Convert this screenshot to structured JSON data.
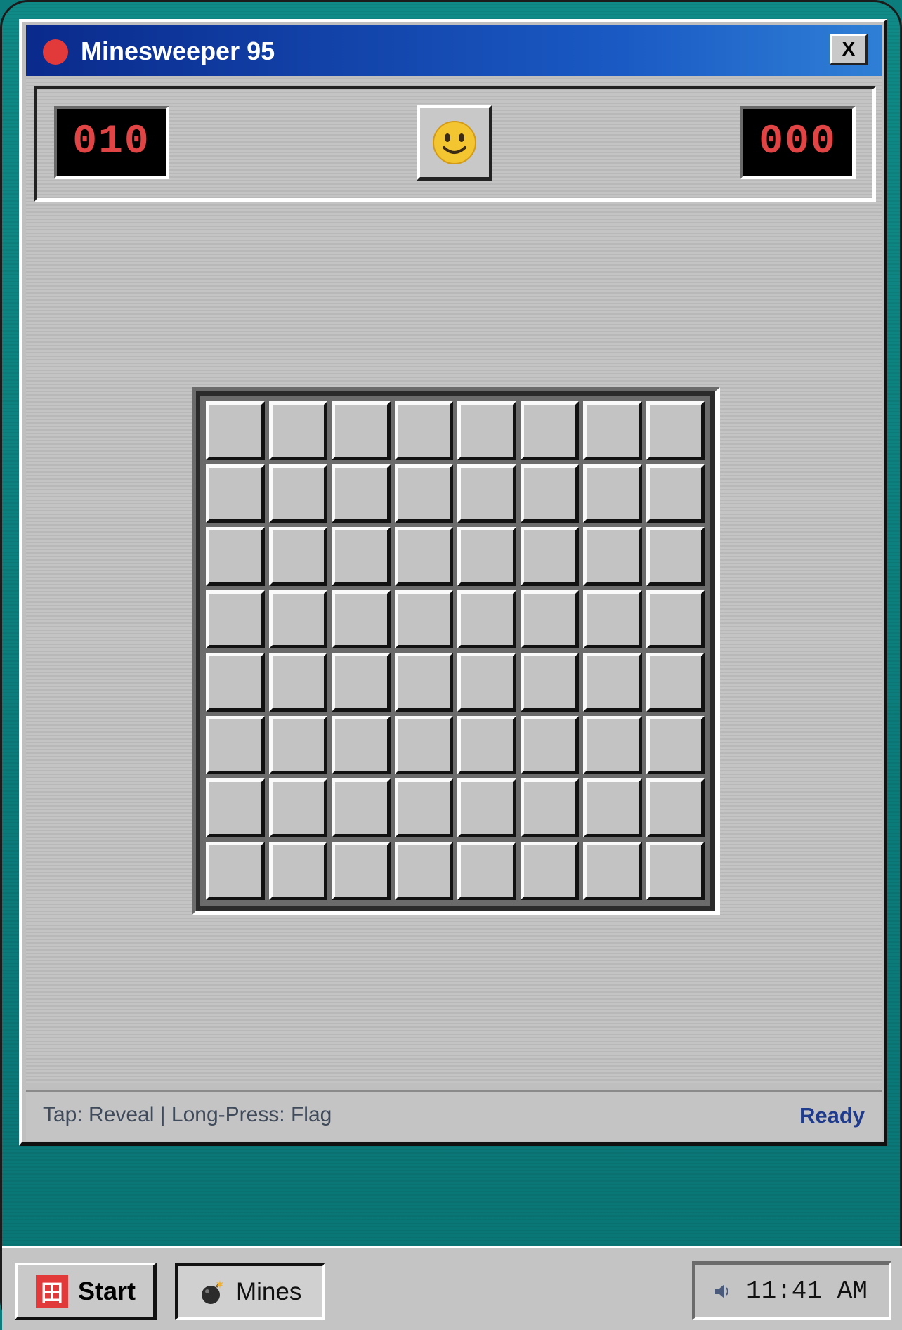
{
  "window": {
    "title": "Minesweeper 95",
    "close_label": "X"
  },
  "header": {
    "mines_remaining": "010",
    "timer": "000",
    "face": "smiley-face-icon"
  },
  "board": {
    "rows": 8,
    "cols": 8,
    "state": "all cells covered"
  },
  "status": {
    "hint": "Tap: Reveal | Long-Press: Flag",
    "state": "Ready"
  },
  "taskbar": {
    "start_label": "Start",
    "start_icon": "田",
    "task_label": "Mines",
    "task_icon": "bomb-icon",
    "clock": "11:41 AM",
    "volume_icon": "speaker-icon"
  },
  "colors": {
    "desktop": "#0b7d7d",
    "titlebar_start": "#0a2a8c",
    "titlebar_end": "#2f7fd6",
    "counter_digits": "#e04444",
    "status_ready": "#1f3c8c",
    "accent_red": "#e23a3a"
  }
}
